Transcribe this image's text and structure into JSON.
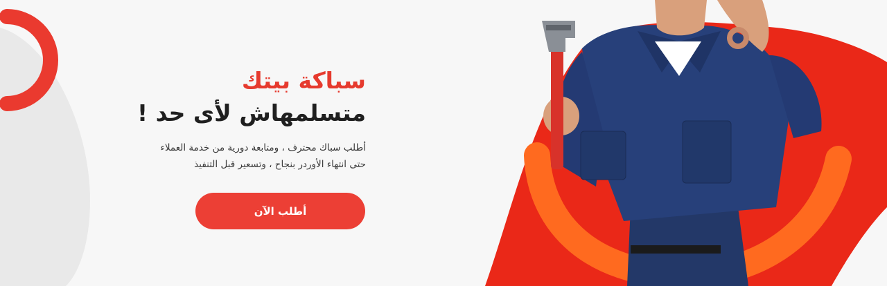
{
  "hero": {
    "title_line1": "سباكة بيتك",
    "title_line2": "متسلمهاش لأى حد !",
    "description_line1": "أطلب سباك محترف ، ومتابعة دورية من خدمة العملاء",
    "description_line2": "حتى انتهاء الأوردر بنجاح ، وتسعير قبل التنفيذ",
    "cta_label": "أطلب الآن",
    "image_subject": "plumber-with-pipe-wrench-ok-gesture"
  },
  "colors": {
    "accent_red": "#ec3f35",
    "accent_orange": "#ff6a1f",
    "uniform_navy": "#243a73",
    "background": "#f7f7f7"
  }
}
